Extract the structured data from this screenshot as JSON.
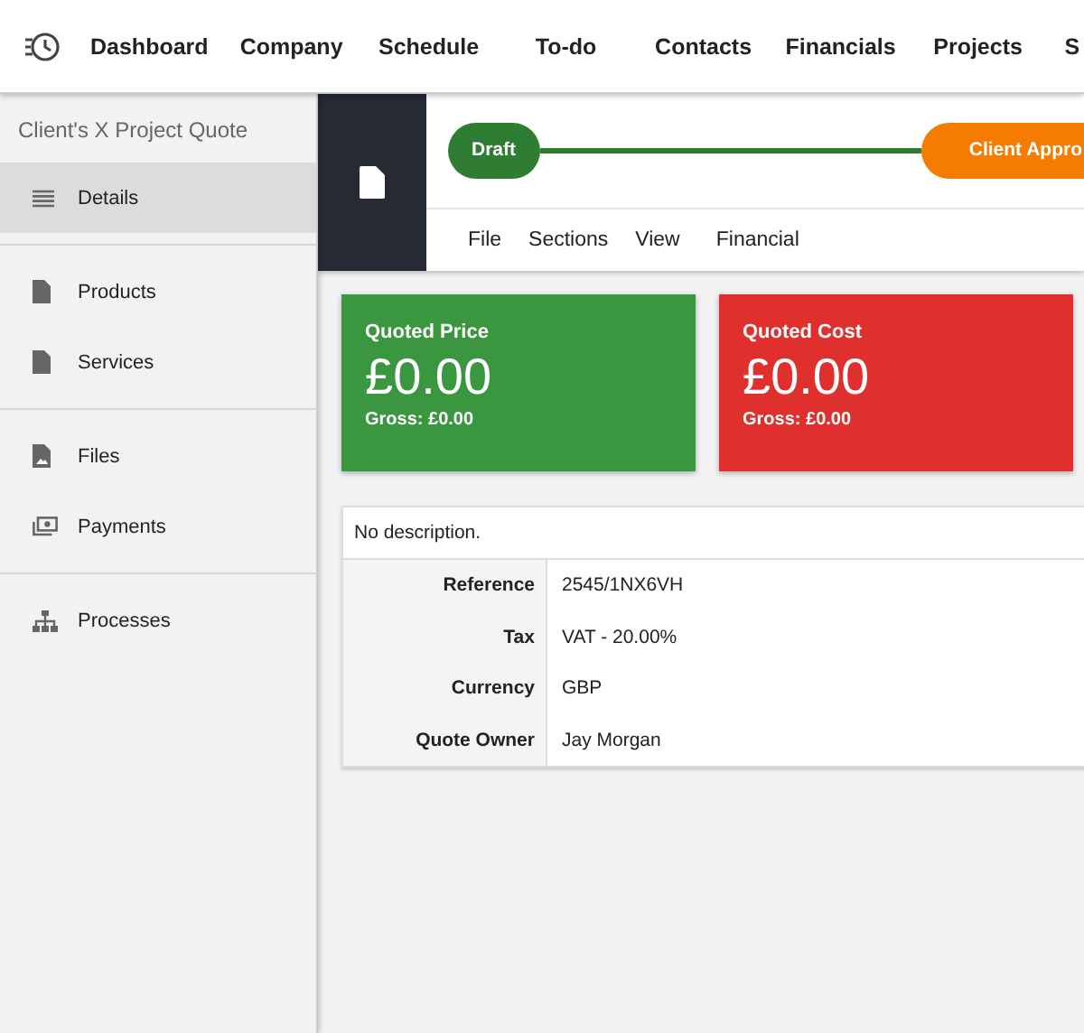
{
  "top_nav": {
    "items": [
      {
        "label": "Dashboard"
      },
      {
        "label": "Company"
      },
      {
        "label": "Schedule"
      },
      {
        "label": "To-do"
      },
      {
        "label": "Contacts"
      },
      {
        "label": "Financials"
      },
      {
        "label": "Projects"
      },
      {
        "label": "S"
      }
    ]
  },
  "sidebar": {
    "title": "Client's X Project Quote",
    "groups": [
      [
        {
          "label": "Details",
          "selected": true
        }
      ],
      [
        {
          "label": "Products",
          "selected": false
        },
        {
          "label": "Services",
          "selected": false
        }
      ],
      [
        {
          "label": "Files",
          "selected": false
        },
        {
          "label": "Payments",
          "selected": false
        }
      ],
      [
        {
          "label": "Processes",
          "selected": false
        }
      ]
    ]
  },
  "stages": [
    {
      "label": "Draft",
      "color": "#2e7d32"
    },
    {
      "label": "Client Appro",
      "color": "#f57c00"
    }
  ],
  "menu": [
    "File",
    "Sections",
    "View",
    "Financial"
  ],
  "cards": [
    {
      "title": "Quoted Price",
      "amount": "£0.00",
      "gross": "Gross: £0.00",
      "color": "#3a963f"
    },
    {
      "title": "Quoted Cost",
      "amount": "£0.00",
      "gross": "Gross: £0.00",
      "color": "#e0302e"
    }
  ],
  "details": {
    "description": "No description.",
    "rows": [
      {
        "label": "Reference",
        "value": "2545/1NX6VH"
      },
      {
        "label": "Tax",
        "value": "VAT - 20.00%"
      },
      {
        "label": "Currency",
        "value": "GBP"
      },
      {
        "label": "Quote Owner",
        "value": "Jay Morgan"
      }
    ]
  }
}
